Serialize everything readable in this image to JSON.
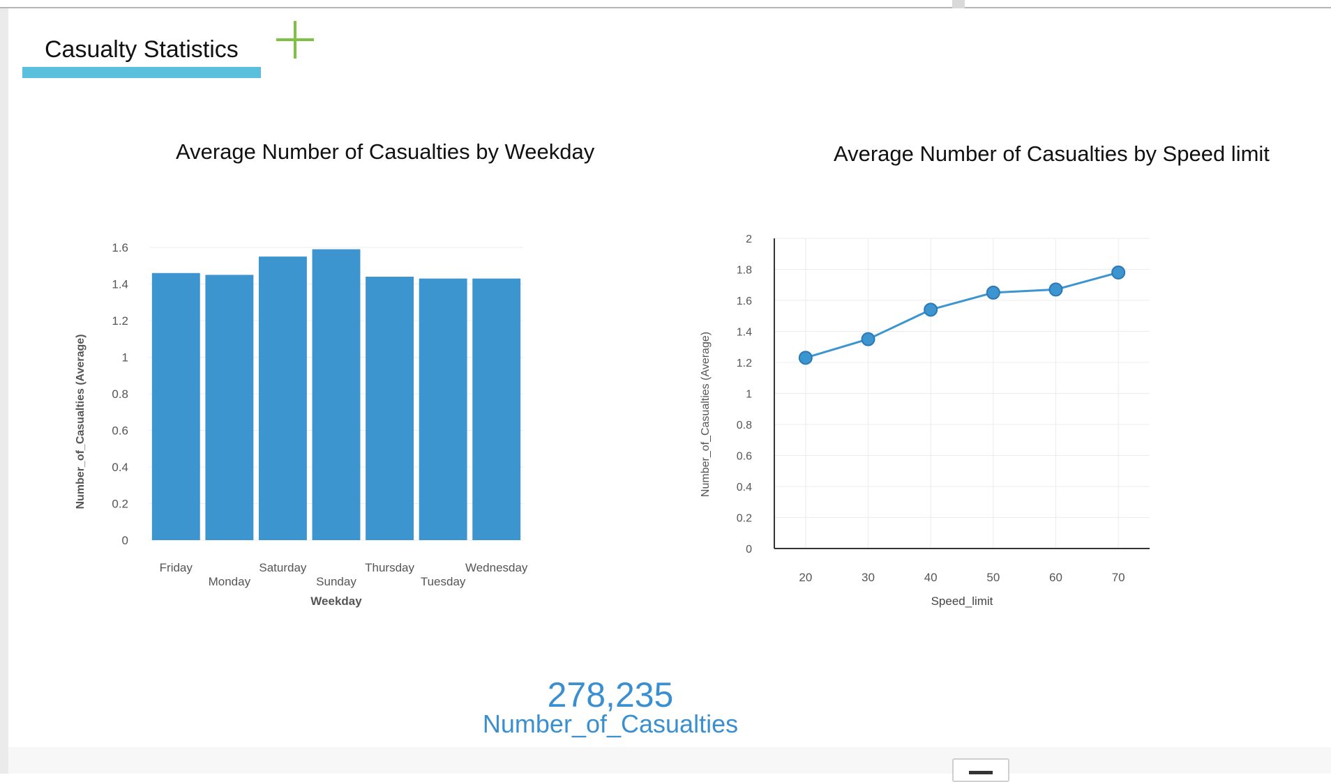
{
  "tab": {
    "label": "Casualty Statistics"
  },
  "colors": {
    "accent": "#5bc0de",
    "add_icon": "#7dc242",
    "bar": "#3d95d0",
    "line": "#3d95d0",
    "kpi": "#3a8fd0"
  },
  "icons": {
    "add_tab": "plus-icon",
    "corner_button": "menu-icon"
  },
  "chart_data": [
    {
      "type": "bar",
      "title": "Average Number of Casualties by Weekday",
      "xlabel": "Weekday",
      "ylabel": "Number_of_Casualties (Average)",
      "categories": [
        "Friday",
        "Monday",
        "Saturday",
        "Sunday",
        "Thursday",
        "Tuesday",
        "Wednesday"
      ],
      "values": [
        1.46,
        1.45,
        1.55,
        1.59,
        1.44,
        1.43,
        1.43
      ],
      "ylim": [
        0,
        1.6
      ],
      "yticks": [
        "0",
        "0.2",
        "0.4",
        "0.6",
        "0.8",
        "1",
        "1.2",
        "1.4",
        "1.6"
      ],
      "grid": true,
      "legend": "none"
    },
    {
      "type": "line",
      "title": "Average Number of Casualties by Speed limit",
      "xlabel": "Speed_limit",
      "ylabel": "Number_of_Casualties (Average)",
      "x": [
        20,
        30,
        40,
        50,
        60,
        70
      ],
      "values": [
        1.23,
        1.35,
        1.54,
        1.65,
        1.67,
        1.78
      ],
      "ylim": [
        0,
        2
      ],
      "yticks": [
        "0",
        "0.2",
        "0.4",
        "0.6",
        "0.8",
        "1",
        "1.2",
        "1.4",
        "1.6",
        "1.8",
        "2"
      ],
      "xticks": [
        "20",
        "30",
        "40",
        "50",
        "60",
        "70"
      ],
      "grid": true,
      "legend": "none"
    }
  ],
  "kpi": {
    "value": "278,235",
    "label": "Number_of_Casualties"
  }
}
